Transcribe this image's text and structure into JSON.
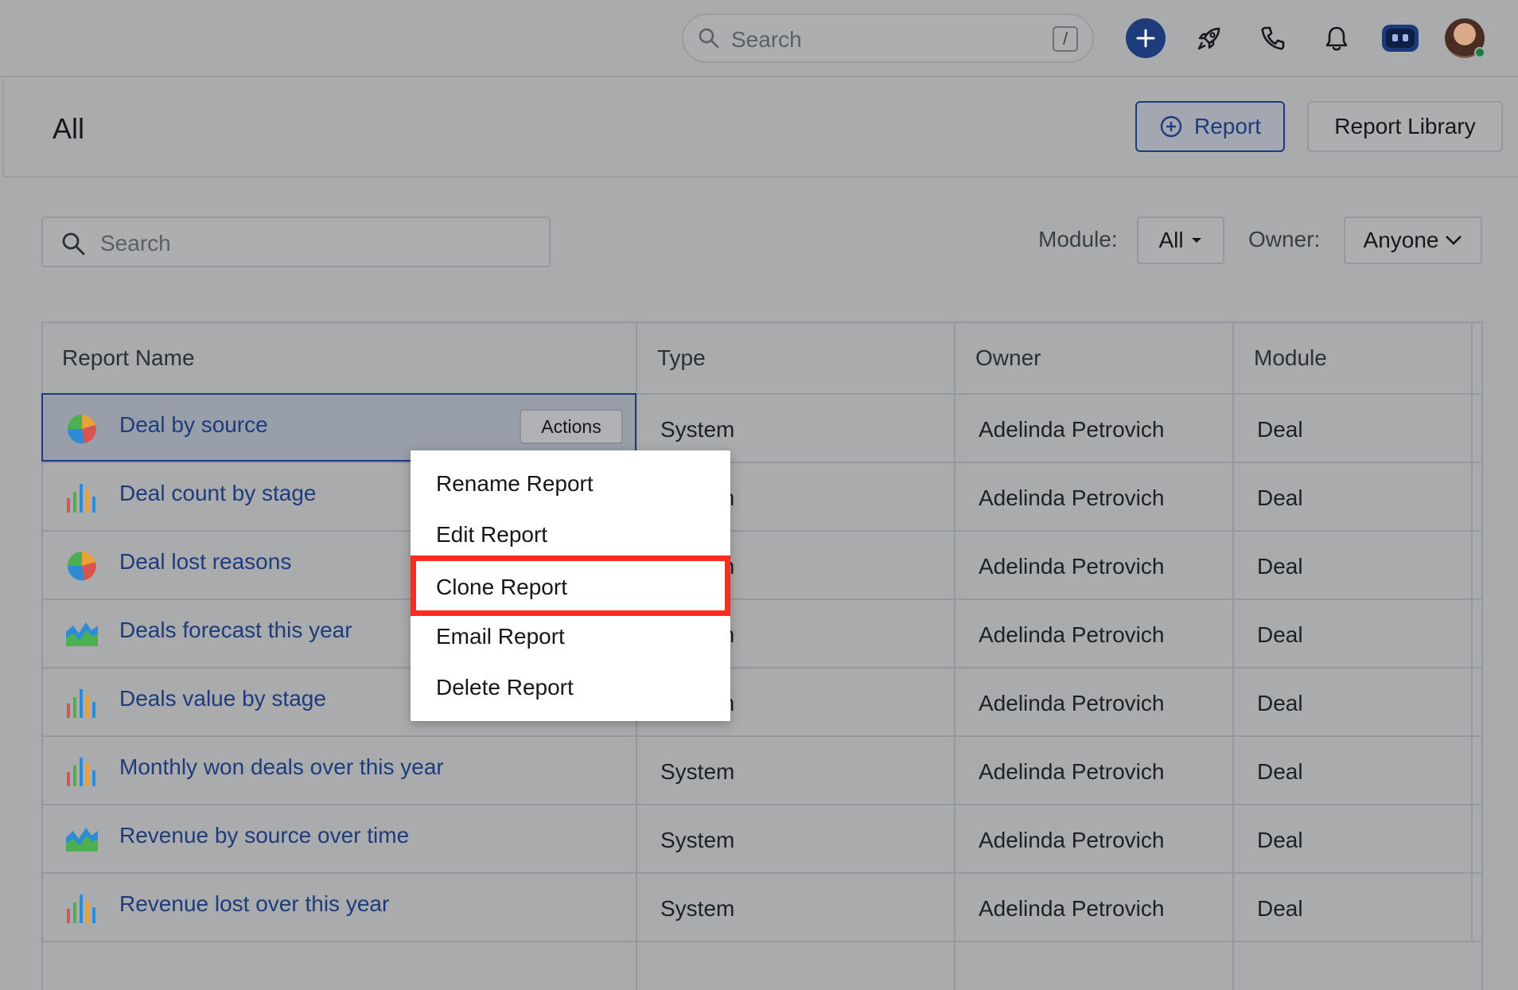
{
  "topbar": {
    "search_placeholder": "Search",
    "search_shortcut": "/",
    "icons": [
      "plus-icon",
      "rocket-icon",
      "phone-icon",
      "bell-icon",
      "bot-icon",
      "avatar"
    ],
    "colors": {
      "accent": "#1e3b7c",
      "status_online": "#15803d"
    }
  },
  "page": {
    "title": "All",
    "add_report_label": "Report",
    "report_library_label": "Report Library"
  },
  "filters": {
    "search_placeholder": "Search",
    "module_label": "Module:",
    "module_value": "All",
    "owner_label": "Owner:",
    "owner_value": "Anyone"
  },
  "table": {
    "columns": [
      "Report Name",
      "Type",
      "Owner",
      "Module"
    ],
    "actions_label": "Actions",
    "rows": [
      {
        "name": "Deal by source",
        "icon": "pie-chart-icon",
        "type": "System",
        "owner": "Adelinda Petrovich",
        "module": "Deal"
      },
      {
        "name": "Deal count by stage",
        "icon": "bar-chart-icon",
        "type": "System",
        "owner": "Adelinda Petrovich",
        "module": "Deal"
      },
      {
        "name": "Deal lost reasons",
        "icon": "pie-chart-icon",
        "type": "System",
        "owner": "Adelinda Petrovich",
        "module": "Deal"
      },
      {
        "name": "Deals forecast this year",
        "icon": "area-chart-icon",
        "type": "System",
        "owner": "Adelinda Petrovich",
        "module": "Deal"
      },
      {
        "name": "Deals value by stage",
        "icon": "bar-chart-icon",
        "type": "System",
        "owner": "Adelinda Petrovich",
        "module": "Deal"
      },
      {
        "name": "Monthly won deals over this year",
        "icon": "bar-chart-icon",
        "type": "System",
        "owner": "Adelinda Petrovich",
        "module": "Deal"
      },
      {
        "name": "Revenue by source over time",
        "icon": "area-chart-icon",
        "type": "System",
        "owner": "Adelinda Petrovich",
        "module": "Deal"
      },
      {
        "name": "Revenue lost over this year",
        "icon": "bar-chart-icon",
        "type": "System",
        "owner": "Adelinda Petrovich",
        "module": "Deal"
      }
    ]
  },
  "menu": {
    "items": [
      "Rename Report",
      "Edit Report",
      "Clone Report",
      "Email Report",
      "Delete Report"
    ],
    "highlighted": "Clone Report",
    "highlight_color": "#ff2b1f"
  }
}
